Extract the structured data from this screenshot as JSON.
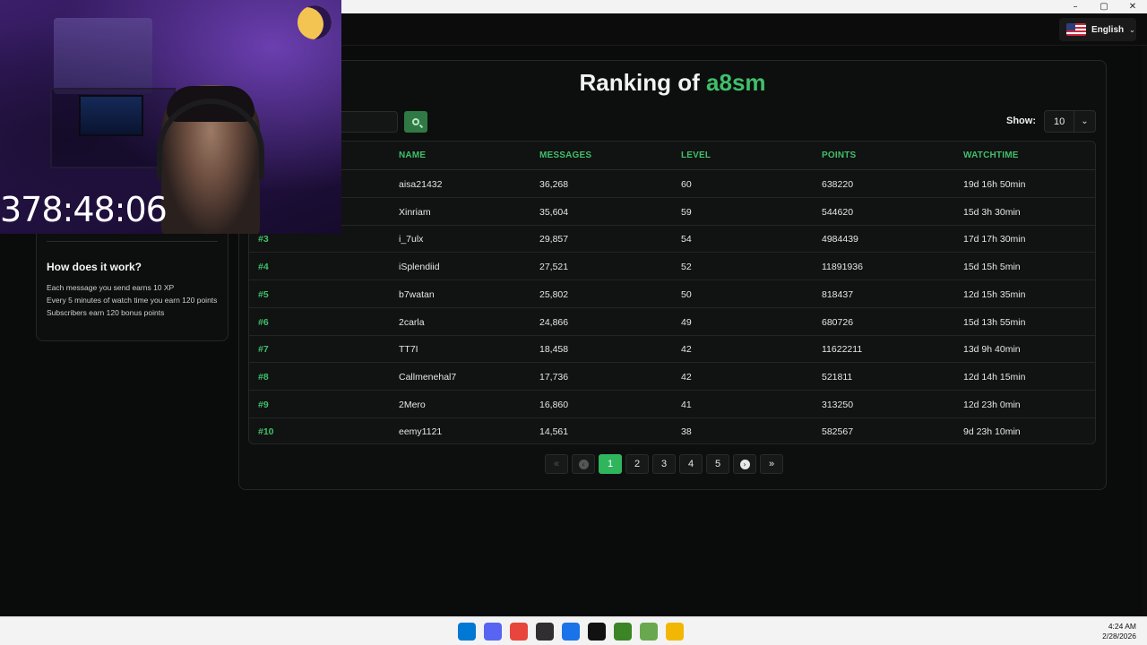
{
  "window": {
    "controls": [
      "–",
      "▢",
      "✕"
    ]
  },
  "header": {
    "language": "English",
    "language_flag_icon": "us-flag-icon"
  },
  "stream_overlay": {
    "timer": "378:48:06"
  },
  "sidebar": {
    "how_title": "How does it work?",
    "how_lines": [
      "Each message you send earns 10 XP",
      "Every 5 minutes of watch time you earn 120 points",
      "Subscribers earn 120 bonus points"
    ]
  },
  "ranking": {
    "title_prefix": "Ranking of",
    "channel": "a8sm",
    "show_label": "Show:",
    "show_value": "10",
    "columns": [
      "NAME",
      "MESSAGES",
      "LEVEL",
      "POINTS",
      "WATCHTIME"
    ],
    "rows": [
      {
        "rank": "",
        "name": "aisa21432",
        "messages": "36,268",
        "level": "60",
        "points": "638220",
        "watchtime": "19d 16h 50min"
      },
      {
        "rank": "",
        "name": "Xinriam",
        "messages": "35,604",
        "level": "59",
        "points": "544620",
        "watchtime": "15d 3h 30min"
      },
      {
        "rank": "#3",
        "name": "i_7ulx",
        "messages": "29,857",
        "level": "54",
        "points": "4984439",
        "watchtime": "17d 17h 30min"
      },
      {
        "rank": "#4",
        "name": "iSplendiid",
        "messages": "27,521",
        "level": "52",
        "points": "11891936",
        "watchtime": "15d 15h 5min"
      },
      {
        "rank": "#5",
        "name": "b7watan",
        "messages": "25,802",
        "level": "50",
        "points": "818437",
        "watchtime": "12d 15h 35min"
      },
      {
        "rank": "#6",
        "name": "2carla",
        "messages": "24,866",
        "level": "49",
        "points": "680726",
        "watchtime": "15d 13h 55min"
      },
      {
        "rank": "#7",
        "name": "TT7I",
        "messages": "18,458",
        "level": "42",
        "points": "11622211",
        "watchtime": "13d 9h 40min"
      },
      {
        "rank": "#8",
        "name": "Callmenehal7",
        "messages": "17,736",
        "level": "42",
        "points": "521811",
        "watchtime": "12d 14h 15min"
      },
      {
        "rank": "#9",
        "name": "2Mero",
        "messages": "16,860",
        "level": "41",
        "points": "313250",
        "watchtime": "12d 23h 0min"
      },
      {
        "rank": "#10",
        "name": "eemy1121",
        "messages": "14,561",
        "level": "38",
        "points": "582567",
        "watchtime": "9d 23h 10min"
      }
    ],
    "pagination": {
      "first": "«",
      "pages": [
        "1",
        "2",
        "3",
        "4",
        "5"
      ],
      "active": "1",
      "last": "»"
    }
  },
  "taskbar": {
    "time": "4:24 AM",
    "date": "2/28/2026",
    "icons": [
      {
        "name": "windows-start-icon",
        "color": "#0078d4"
      },
      {
        "name": "discord-icon",
        "color": "#5865f2"
      },
      {
        "name": "chrome-icon",
        "color": "#e8453c"
      },
      {
        "name": "obs-icon",
        "color": "#302e31"
      },
      {
        "name": "bing-icon",
        "color": "#1a73e8"
      },
      {
        "name": "capcut-icon",
        "color": "#111111"
      },
      {
        "name": "minecraft-icon",
        "color": "#3c8527"
      },
      {
        "name": "minecraft-launcher-icon",
        "color": "#6aa84f"
      },
      {
        "name": "file-explorer-icon",
        "color": "#f2b705"
      }
    ]
  }
}
